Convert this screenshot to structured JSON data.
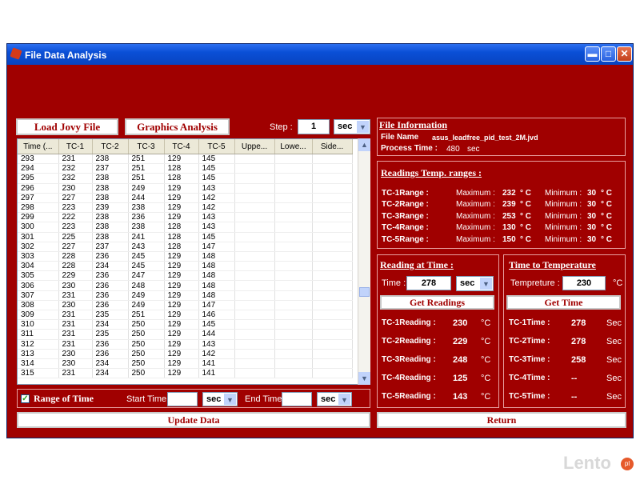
{
  "window": {
    "title": "File Data Analysis"
  },
  "toolbar": {
    "load_label": "Load Jovy File",
    "graphics_label": "Graphics Analysis",
    "step_label": "Step :",
    "step_value": "1",
    "step_unit": "sec"
  },
  "grid": {
    "columns": [
      "Time (...",
      "TC-1",
      "TC-2",
      "TC-3",
      "TC-4",
      "TC-5",
      "Uppe...",
      "Lowe...",
      "Side..."
    ],
    "rows": [
      [
        "293",
        "231",
        "238",
        "251",
        "129",
        "145"
      ],
      [
        "294",
        "232",
        "237",
        "251",
        "128",
        "145"
      ],
      [
        "295",
        "232",
        "238",
        "251",
        "128",
        "145"
      ],
      [
        "296",
        "230",
        "238",
        "249",
        "129",
        "143"
      ],
      [
        "297",
        "227",
        "238",
        "244",
        "129",
        "142"
      ],
      [
        "298",
        "223",
        "239",
        "238",
        "129",
        "142"
      ],
      [
        "299",
        "222",
        "238",
        "236",
        "129",
        "143"
      ],
      [
        "300",
        "223",
        "238",
        "238",
        "128",
        "143"
      ],
      [
        "301",
        "225",
        "238",
        "241",
        "128",
        "145"
      ],
      [
        "302",
        "227",
        "237",
        "243",
        "128",
        "147"
      ],
      [
        "303",
        "228",
        "236",
        "245",
        "129",
        "148"
      ],
      [
        "304",
        "228",
        "234",
        "245",
        "129",
        "148"
      ],
      [
        "305",
        "229",
        "236",
        "247",
        "129",
        "148"
      ],
      [
        "306",
        "230",
        "236",
        "248",
        "129",
        "148"
      ],
      [
        "307",
        "231",
        "236",
        "249",
        "129",
        "148"
      ],
      [
        "308",
        "230",
        "236",
        "249",
        "129",
        "147"
      ],
      [
        "309",
        "231",
        "235",
        "251",
        "129",
        "146"
      ],
      [
        "310",
        "231",
        "234",
        "250",
        "129",
        "145"
      ],
      [
        "311",
        "231",
        "235",
        "250",
        "129",
        "144"
      ],
      [
        "312",
        "231",
        "236",
        "250",
        "129",
        "143"
      ],
      [
        "313",
        "230",
        "236",
        "250",
        "129",
        "142"
      ],
      [
        "314",
        "230",
        "234",
        "250",
        "129",
        "141"
      ],
      [
        "315",
        "231",
        "234",
        "250",
        "129",
        "141"
      ]
    ]
  },
  "range": {
    "label": "Range of Time",
    "start_label": "Start Time :",
    "start_value": "",
    "start_unit": "sec",
    "end_label": "End Time :",
    "end_value": "",
    "end_unit": "sec"
  },
  "update_label": "Update Data",
  "return_label": "Return",
  "file_info": {
    "title": "File Information",
    "name_label": "File Name",
    "name_value": "asus_leadfree_pid_test_2M.jvd",
    "process_label": "Process Time :",
    "process_value": "480",
    "process_unit": "sec"
  },
  "ranges": {
    "title": "Readings Temp. ranges :",
    "max_label": "Maximum :",
    "min_label": "Minimum :",
    "unit": "° C",
    "items": [
      {
        "label": "TC-1Range :",
        "max": "232",
        "min": "30"
      },
      {
        "label": "TC-2Range :",
        "max": "239",
        "min": "30"
      },
      {
        "label": "TC-3Range :",
        "max": "253",
        "min": "30"
      },
      {
        "label": "TC-4Range :",
        "max": "130",
        "min": "30"
      },
      {
        "label": "TC-5Range :",
        "max": "150",
        "min": "30"
      }
    ]
  },
  "reading": {
    "title": "Reading at Time :",
    "time_label": "Time :",
    "time_value": "278",
    "time_unit": "sec",
    "button": "Get Readings",
    "unit": "°C",
    "items": [
      {
        "label": "TC-1Reading :",
        "value": "230"
      },
      {
        "label": "TC-2Reading :",
        "value": "229"
      },
      {
        "label": "TC-3Reading :",
        "value": "248"
      },
      {
        "label": "TC-4Reading :",
        "value": "125"
      },
      {
        "label": "TC-5Reading :",
        "value": "143"
      }
    ]
  },
  "totemp": {
    "title": "Time to Temperature",
    "temp_label": "Tempreture :",
    "temp_value": "230",
    "temp_unit": "°C",
    "button": "Get Time",
    "unit": "Sec",
    "items": [
      {
        "label": "TC-1Time :",
        "value": "278"
      },
      {
        "label": "TC-2Time :",
        "value": "278"
      },
      {
        "label": "TC-3Time :",
        "value": "258"
      },
      {
        "label": "TC-4Time :",
        "value": "--"
      },
      {
        "label": "TC-5Time :",
        "value": "--"
      }
    ]
  },
  "watermark": "Lento",
  "watermark_badge": "pl"
}
